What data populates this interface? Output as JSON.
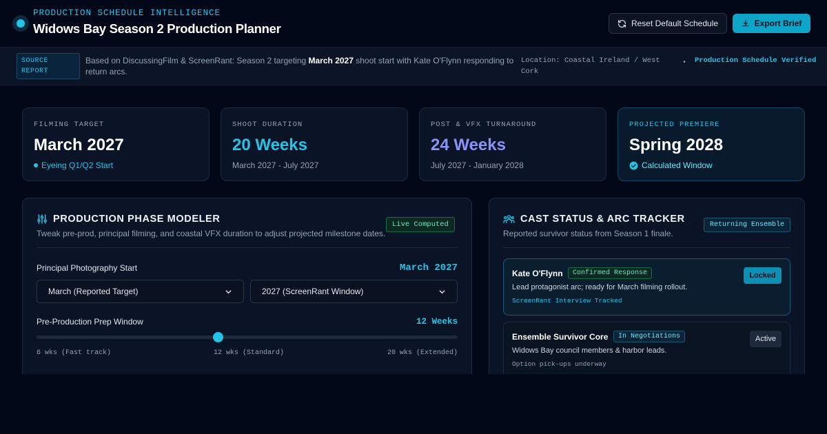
{
  "header": {
    "kicker": "PRODUCTION SCHEDULE INTELLIGENCE",
    "title": "Widows Bay Season 2 Production Planner",
    "reset_label": "Reset Default Schedule",
    "export_label": "Export Brief"
  },
  "source": {
    "badge": "SOURCE REPORT",
    "text_before": "Based on DiscussingFilm & ScreenRant: Season 2 targeting ",
    "text_bold": "March 2027",
    "text_after": " shoot start with Kate O'Flynn responding to return arcs.",
    "location": "Location: Coastal Ireland / West Cork",
    "separator": "•",
    "verified": "Production Schedule Verified"
  },
  "stats": [
    {
      "label": "FILMING TARGET",
      "value": "March 2027",
      "sub": "Eyeing Q1/Q2 Start",
      "value_color": "#ffffff",
      "sub_color": "#22c4e8"
    },
    {
      "label": "SHOOT DURATION",
      "value": "20 Weeks",
      "sub": "March 2027 - July 2027",
      "value_color": "#22c4e8",
      "sub_color": "#94a3b8"
    },
    {
      "label": "POST & VFX TURNAROUND",
      "value": "24 Weeks",
      "sub": "July 2027 - January 2028",
      "value_color": "#8b93f8",
      "sub_color": "#94a3b8"
    },
    {
      "label": "PROJECTED PREMIERE",
      "value": "Spring 2028",
      "sub": "Calculated Window",
      "value_color": "#ffffff",
      "sub_color": "#67e8f9"
    }
  ],
  "phase": {
    "title": "PRODUCTION PHASE MODELER",
    "subtitle": "Tweak pre-prod, principal filming, and coastal VFX duration to adjust projected milestone dates.",
    "badge": "Live Computed",
    "start_label": "Principal Photography Start",
    "start_value": "March 2027",
    "month_select": "March (Reported Target)",
    "year_select": "2027 (ScreenRant Window)",
    "prep_label": "Pre-Production Prep Window",
    "prep_value": "12 Weeks",
    "prep_fraction": 0.43,
    "ticks": [
      "6 wks (Fast track)",
      "12 wks (Standard)",
      "20 wks (Extended)"
    ]
  },
  "cast": {
    "title": "CAST STATUS & ARC TRACKER",
    "subtitle": "Reported survivor status from Season 1 finale.",
    "badge": "Returning Ensemble",
    "members": [
      {
        "name": "Kate O'Flynn",
        "status": "Confirmed Response",
        "desc": "Lead protagonist arc; ready for March filming rollout.",
        "note": "ScreenRant Interview Tracked",
        "button": "Locked"
      },
      {
        "name": "Ensemble Survivor Core",
        "status": "In Negotiations",
        "desc": "Widows Bay council members & harbor leads.",
        "note": "Option pick-ups underway",
        "button": "Active"
      }
    ]
  },
  "colors": {
    "accent": "#22c4e8",
    "background": "#020817",
    "card": "#0b1426",
    "indigo": "#8b93f8"
  }
}
